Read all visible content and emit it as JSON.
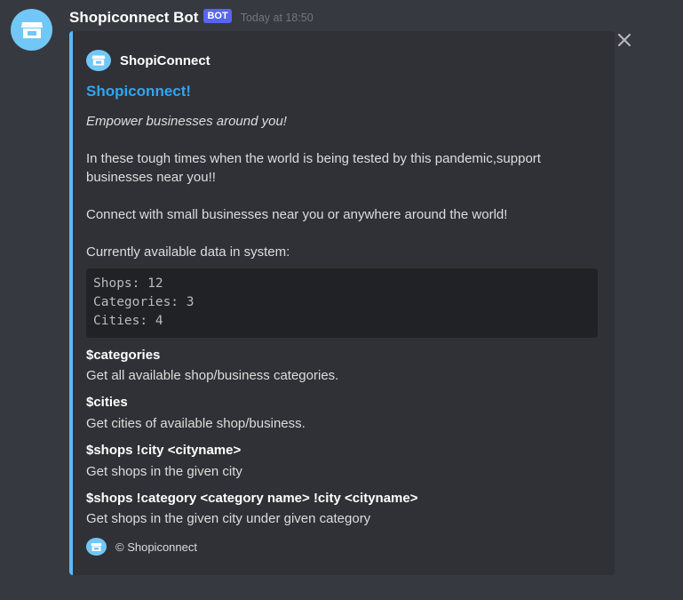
{
  "message": {
    "username": "Shopiconnect Bot",
    "bot_tag": "BOT",
    "timestamp": "Today at 18:50",
    "avatar_icon": "shop-icon",
    "close_icon": "close-icon"
  },
  "embed": {
    "accent_color": "#5cb9f4",
    "author": "ShopiConnect",
    "title": "Shopiconnect!",
    "tagline": "Empower businesses around you!",
    "paragraph1_line1": "In these tough times when the world is being tested by this pandemic,support",
    "paragraph1_line2": "businesses near you!!",
    "paragraph2": "Connect with small businesses near you or anywhere around the world!",
    "paragraph3": "Currently available data in system:",
    "code_lines": [
      "Shops: 12",
      "Categories: 3",
      "Cities: 4"
    ],
    "fields": [
      {
        "name": "$categories",
        "value": "Get all available shop/business categories."
      },
      {
        "name": "$cities",
        "value": "Get cities of available shop/business."
      },
      {
        "name": "$shops !city <cityname>",
        "value": "Get shops in the given city"
      },
      {
        "name": "$shops !category <category name> !city <cityname>",
        "value": "Get shops in the given city under given category"
      }
    ],
    "footer": "© Shopiconnect"
  }
}
